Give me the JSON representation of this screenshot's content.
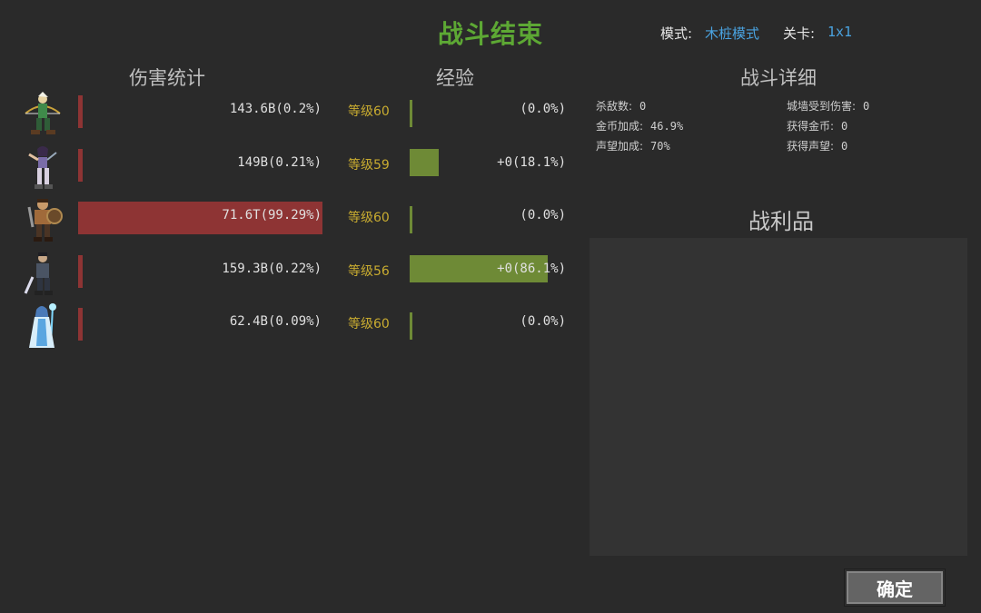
{
  "header": {
    "title": "战斗结束",
    "mode_label": "模式:",
    "mode_value": "木桩模式",
    "level_label": "关卡:",
    "level_value": "1x1"
  },
  "sections": {
    "damage": "伤害统计",
    "experience": "经验",
    "details": "战斗详细",
    "loot": "战利品"
  },
  "heroes": [
    {
      "icon": "elf-archer-icon",
      "damage": "143.6B(0.2%)",
      "damage_share": 0.002,
      "level": "等级60",
      "xp": "(0.0%)",
      "xp_progress": 0.0
    },
    {
      "icon": "female-warrior-icon",
      "damage": "149B(0.21%)",
      "damage_share": 0.0021,
      "level": "等级59",
      "xp": "+0(18.1%)",
      "xp_progress": 0.181
    },
    {
      "icon": "barbarian-icon",
      "damage": "71.6T(99.29%)",
      "damage_share": 0.9929,
      "level": "等级60",
      "xp": "(0.0%)",
      "xp_progress": 0.0
    },
    {
      "icon": "swordsman-icon",
      "damage": "159.3B(0.22%)",
      "damage_share": 0.0022,
      "level": "等级56",
      "xp": "+0(86.1%)",
      "xp_progress": 0.861
    },
    {
      "icon": "ice-mage-icon",
      "damage": "62.4B(0.09%)",
      "damage_share": 0.0009,
      "level": "等级60",
      "xp": "(0.0%)",
      "xp_progress": 0.0
    }
  ],
  "details": {
    "kills_label": "杀敌数:",
    "kills": "0",
    "wall_damage_label": "城墙受到伤害:",
    "wall_damage": "0",
    "gold_bonus_label": "金币加成:",
    "gold_bonus": "46.9%",
    "gold_gain_label": "获得金币:",
    "gold_gain": "0",
    "rep_bonus_label": "声望加成:",
    "rep_bonus": "70%",
    "rep_gain_label": "获得声望:",
    "rep_gain": "0"
  },
  "confirm_label": "确定",
  "colors": {
    "damage_bar": "#8e3434",
    "xp_bar": "#6e8a36",
    "title": "#5da834",
    "level_text": "#c9ac30",
    "link": "#4aa3e0"
  }
}
